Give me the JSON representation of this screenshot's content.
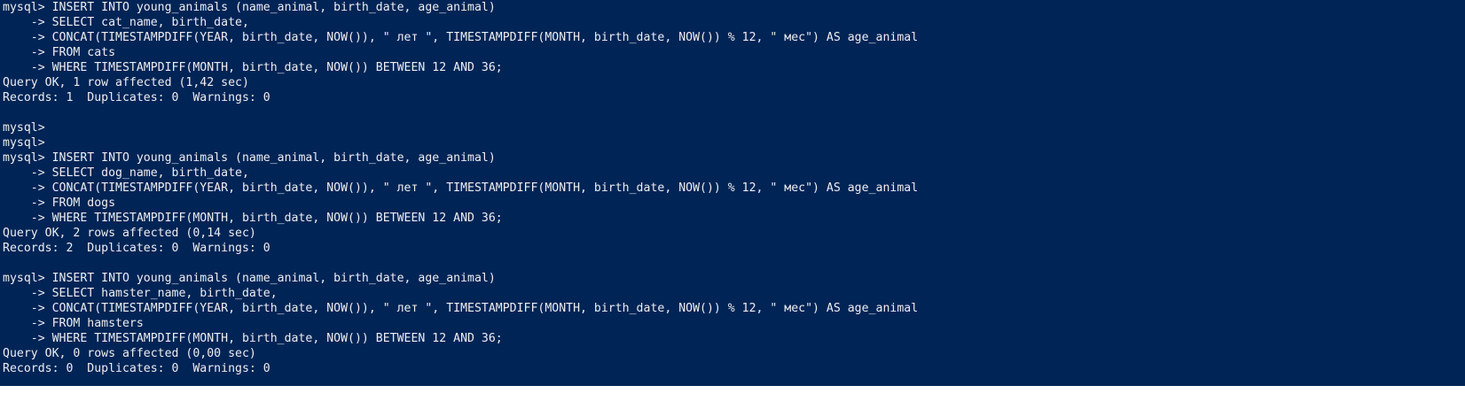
{
  "console": {
    "lines": [
      "mysql> INSERT INTO young_animals (name_animal, birth_date, age_animal)",
      "    -> SELECT cat_name, birth_date,",
      "    -> CONCAT(TIMESTAMPDIFF(YEAR, birth_date, NOW()), \" лет \", TIMESTAMPDIFF(MONTH, birth_date, NOW()) % 12, \" мес\") AS age_animal",
      "    -> FROM cats",
      "    -> WHERE TIMESTAMPDIFF(MONTH, birth_date, NOW()) BETWEEN 12 AND 36;",
      "Query OK, 1 row affected (1,42 sec)",
      "Records: 1  Duplicates: 0  Warnings: 0",
      "",
      "mysql>",
      "mysql>",
      "mysql> INSERT INTO young_animals (name_animal, birth_date, age_animal)",
      "    -> SELECT dog_name, birth_date,",
      "    -> CONCAT(TIMESTAMPDIFF(YEAR, birth_date, NOW()), \" лет \", TIMESTAMPDIFF(MONTH, birth_date, NOW()) % 12, \" мес\") AS age_animal",
      "    -> FROM dogs",
      "    -> WHERE TIMESTAMPDIFF(MONTH, birth_date, NOW()) BETWEEN 12 AND 36;",
      "Query OK, 2 rows affected (0,14 sec)",
      "Records: 2  Duplicates: 0  Warnings: 0",
      "",
      "mysql> INSERT INTO young_animals (name_animal, birth_date, age_animal)",
      "    -> SELECT hamster_name, birth_date,",
      "    -> CONCAT(TIMESTAMPDIFF(YEAR, birth_date, NOW()), \" лет \", TIMESTAMPDIFF(MONTH, birth_date, NOW()) % 12, \" мес\") AS age_animal",
      "    -> FROM hamsters",
      "    -> WHERE TIMESTAMPDIFF(MONTH, birth_date, NOW()) BETWEEN 12 AND 36;",
      "Query OK, 0 rows affected (0,00 sec)",
      "Records: 0  Duplicates: 0  Warnings: 0"
    ]
  },
  "colors": {
    "background": "#012456",
    "text": "#eeedf0"
  }
}
